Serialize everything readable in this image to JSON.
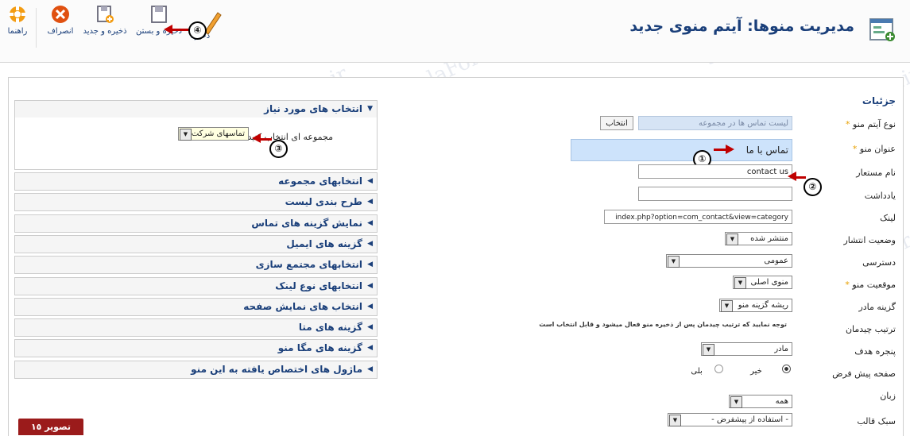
{
  "toolbar": {
    "help": "راهنما",
    "cancel": "انصراف",
    "save_new": "ذخیره و جدید",
    "save_close": "ذخیره و بستن",
    "save": "ذخیره"
  },
  "page_title": "مدیریت منوها: آیتم منوی جدید",
  "details_heading": "جزئیات",
  "form": {
    "menu_item_type": {
      "label": "نوع آیتم منو",
      "value": "لیست تماس ها در مجموعه",
      "button": "انتخاب"
    },
    "menu_title": {
      "label": "عنوان منو",
      "value": "تماس با ما"
    },
    "alias": {
      "label": "نام مستعار",
      "value": "contact us"
    },
    "note": {
      "label": "یادداشت",
      "value": ""
    },
    "link": {
      "label": "لینک",
      "value": "index.php?option=com_contact&view=category"
    },
    "status": {
      "label": "وضعیت انتشار",
      "value": "منتشر شده"
    },
    "access": {
      "label": "دسترسی",
      "value": "عمومی"
    },
    "menu_location": {
      "label": "موقعیت منو",
      "value": "منوی اصلی"
    },
    "parent_item": {
      "label": "گزینه مادر",
      "value": "ریشه گزینه منو"
    },
    "ordering": {
      "label": "ترتیب چیدمان",
      "note": "توجه نمایید که ترتیب چیدمان پس از ذخیره منو فعال میشود و قابل انتخاب است"
    },
    "target_window": {
      "label": "پنجره هدف",
      "value": "مادر"
    },
    "default_page": {
      "label": "صفحه پیش فرض",
      "option_no": "خیر",
      "option_yes": "بلی"
    },
    "language": {
      "label": "زبان",
      "value": "همه"
    },
    "template_style": {
      "label": "سبک قالب",
      "value": "- استفاده از پیشفرض -"
    }
  },
  "accordion": {
    "required": {
      "title": "انتخاب های مورد نیاز",
      "field_label": "مجموعه ای انتخاب کنید",
      "field_value": "تماسهای شرکت"
    },
    "sections": [
      "انتخابهای مجموعه",
      "طرح بندی لیست",
      "نمایش گزینه های تماس",
      "گزینه های ایمیل",
      "انتخابهای مجتمع سازی",
      "انتخابهای نوع لینک",
      "انتخاب های نمایش صفحه",
      "گزینه های متا",
      "گزینه های مگا منو",
      "ماژول های اختصاص یافته به این منو"
    ]
  },
  "annotations": {
    "one": "①",
    "two": "②",
    "three": "③",
    "four": "④"
  },
  "image_label": "تصویر ١٥",
  "watermark": "JoomlaForum.ir",
  "colors": {
    "title": "#1a3f7a",
    "arrow": "#c00000",
    "star": "#e8a000",
    "badge_bg": "#9b1b1b"
  }
}
